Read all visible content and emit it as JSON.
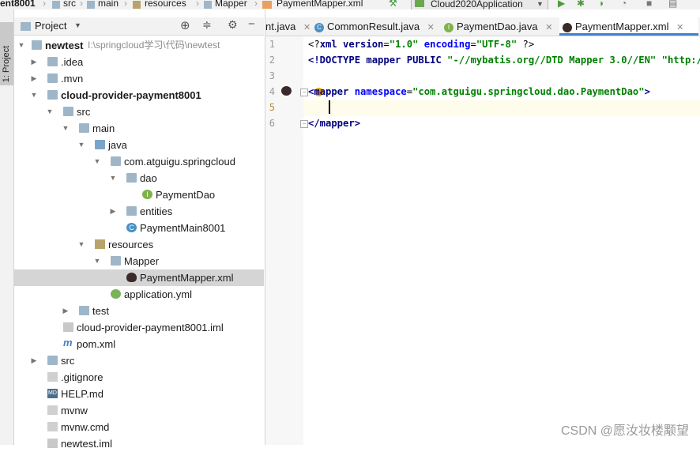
{
  "navbar": {
    "crumb_project": "ent8001",
    "crumb_src": "src",
    "crumb_main": "main",
    "crumb_resources": "resources",
    "crumb_mapper": "Mapper",
    "crumb_file": "PaymentMapper.xml",
    "run_config": "Cloud2020Application"
  },
  "toolstrip": {
    "project_tab": "1: Project"
  },
  "panel": {
    "title": "Project"
  },
  "tree": {
    "root_name": "newtest",
    "root_path": "I:\\springcloud学习\\代码\\newtest",
    "idea": ".idea",
    "mvn": ".mvn",
    "module": "cloud-provider-payment8001",
    "src": "src",
    "main": "main",
    "java": "java",
    "pkg": "com.atguigu.springcloud",
    "dao": "dao",
    "payment_dao": "PaymentDao",
    "entities": "entities",
    "payment_main": "PaymentMain8001",
    "resources": "resources",
    "mapper": "Mapper",
    "mapper_xml": "PaymentMapper.xml",
    "app_yml": "application.yml",
    "test": "test",
    "module_iml": "cloud-provider-payment8001.iml",
    "pom": "pom.xml",
    "root_src": "src",
    "gitignore": ".gitignore",
    "help": "HELP.md",
    "mvnw": "mvnw",
    "mvnw_cmd": "mvnw.cmd",
    "newtest_iml": "newtest.iml"
  },
  "tabs": {
    "t1": "nt.java",
    "t2": "CommonResult.java",
    "t3": "PaymentDao.java",
    "t4": "PaymentMapper.xml"
  },
  "editor": {
    "ln1": "1",
    "ln2": "2",
    "ln3": "3",
    "ln4": "4",
    "ln5": "5",
    "ln6": "6",
    "l1_a": "<?",
    "l1_b": "xml version",
    "l1_c": "=",
    "l1_d": "\"1.0\"",
    "l1_e": " encoding",
    "l1_f": "=",
    "l1_g": "\"UTF-8\"",
    "l1_h": " ?>",
    "l2_a": "<!DOCTYPE mapper PUBLIC ",
    "l2_b": "\"-//mybatis.org//DTD Mapper 3.0//EN\"",
    "l2_c": " \"http://my",
    "l4_a": "<mapper ",
    "l4_b": "namespace",
    "l4_c": "=",
    "l4_d": "\"com.atguigu.springcloud.dao.PaymentDao\"",
    "l4_e": ">",
    "l6_a": "</mapper>"
  },
  "watermark": "CSDN @愿汝妆楼颙望",
  "colors": {
    "tab_underline": "#4083c9",
    "selection": "#d5d5d5",
    "string": "#008000",
    "tag": "#000080"
  }
}
